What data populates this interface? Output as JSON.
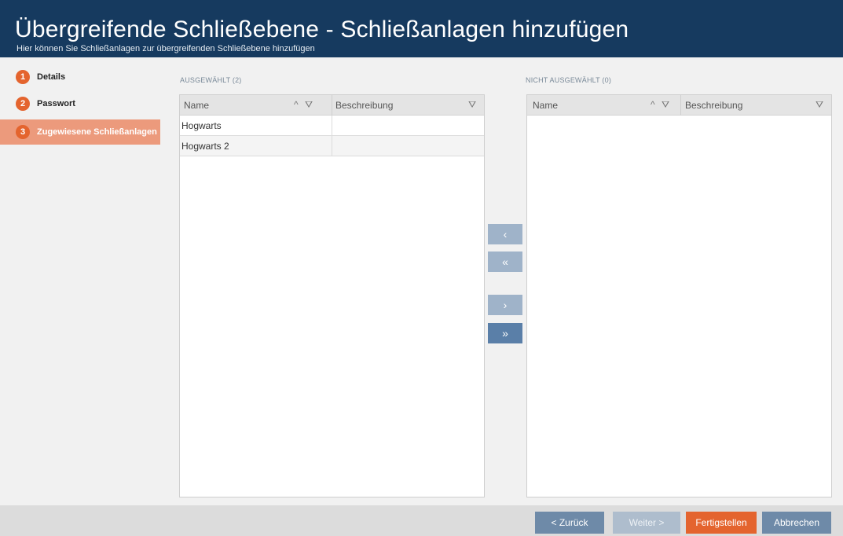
{
  "header": {
    "title": "Übergreifende Schließebene - Schließanlagen hinzufügen",
    "subtitle": "Hier können Sie Schließanlagen zur übergreifenden Schließebene hinzufügen"
  },
  "steps": [
    {
      "num": "1",
      "label": "Details"
    },
    {
      "num": "2",
      "label": "Passwort"
    },
    {
      "num": "3",
      "label": "Zugewiesene Schließanlagen",
      "active": true
    }
  ],
  "selected": {
    "label": "AUSGEWÄHLT (2)",
    "columns": {
      "name": "Name",
      "description": "Beschreibung"
    },
    "rows": [
      {
        "name": "Hogwarts",
        "description": ""
      },
      {
        "name": "Hogwarts 2",
        "description": ""
      }
    ]
  },
  "unselected": {
    "label": "NICHT AUSGEWÄHLT (0)",
    "columns": {
      "name": "Name",
      "description": "Beschreibung"
    },
    "rows": []
  },
  "transfer": {
    "remove_one": "‹",
    "remove_all": "«",
    "add_one": "›",
    "add_all": "»"
  },
  "footer": {
    "back": "< Zurück",
    "next": "Weiter >",
    "finish": "Fertigstellen",
    "cancel": "Abbrechen"
  },
  "icons": {
    "sort": "^",
    "filter": "⛛"
  },
  "colors": {
    "header_bg": "#163a5f",
    "accent_orange": "#e4642e",
    "active_step_bg": "#ec9a7c",
    "button_blue": "#6e8aa8"
  }
}
